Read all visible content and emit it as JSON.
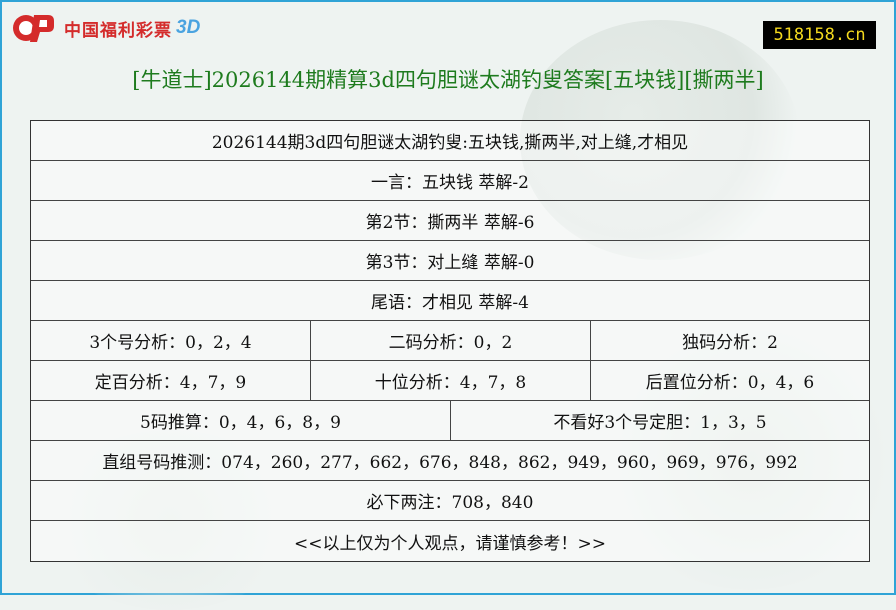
{
  "brand": {
    "logo_text": "中国福利彩票",
    "logo_suffix": "3D",
    "logo_red": "#d42b2b",
    "logo_blue": "#4aa3e0"
  },
  "site": {
    "domain": "518158.cn",
    "badge_bg": "#000000",
    "badge_fg": "#f4d91e"
  },
  "title": "[牛道士]2026144期精算3d四句胆谜太湖钓叟答案[五块钱][撕两半]",
  "title_color": "#1e7b1e",
  "rows": {
    "heading": "2026144期3d四句胆谜太湖钓叟:五块钱,撕两半,对上缝,才相见",
    "line1": "一言：五块钱 萃解-2",
    "line2": "第2节：撕两半 萃解-6",
    "line3": "第3节：对上缝 萃解-0",
    "line4": "尾语：才相见 萃解-4",
    "three_num": "3个号分析：0，2，4",
    "two_code": "二码分析：0，2",
    "single_code": "独码分析：2",
    "hundreds": "定百分析：4，7，9",
    "tens": "十位分析：4，7，8",
    "back_pos": "后置位分析：0，4，6",
    "five_code": "5码推算：0，4，6，8，9",
    "not_favored": "不看好3个号定胆：1，3，5",
    "direct_group": "直组号码推测：074，260，277，662，676，848，862，949，960，969，976，992",
    "must_bets": "必下两注：708，840",
    "disclaimer": "<<以上仅为个人观点，请谨慎参考！>>"
  }
}
